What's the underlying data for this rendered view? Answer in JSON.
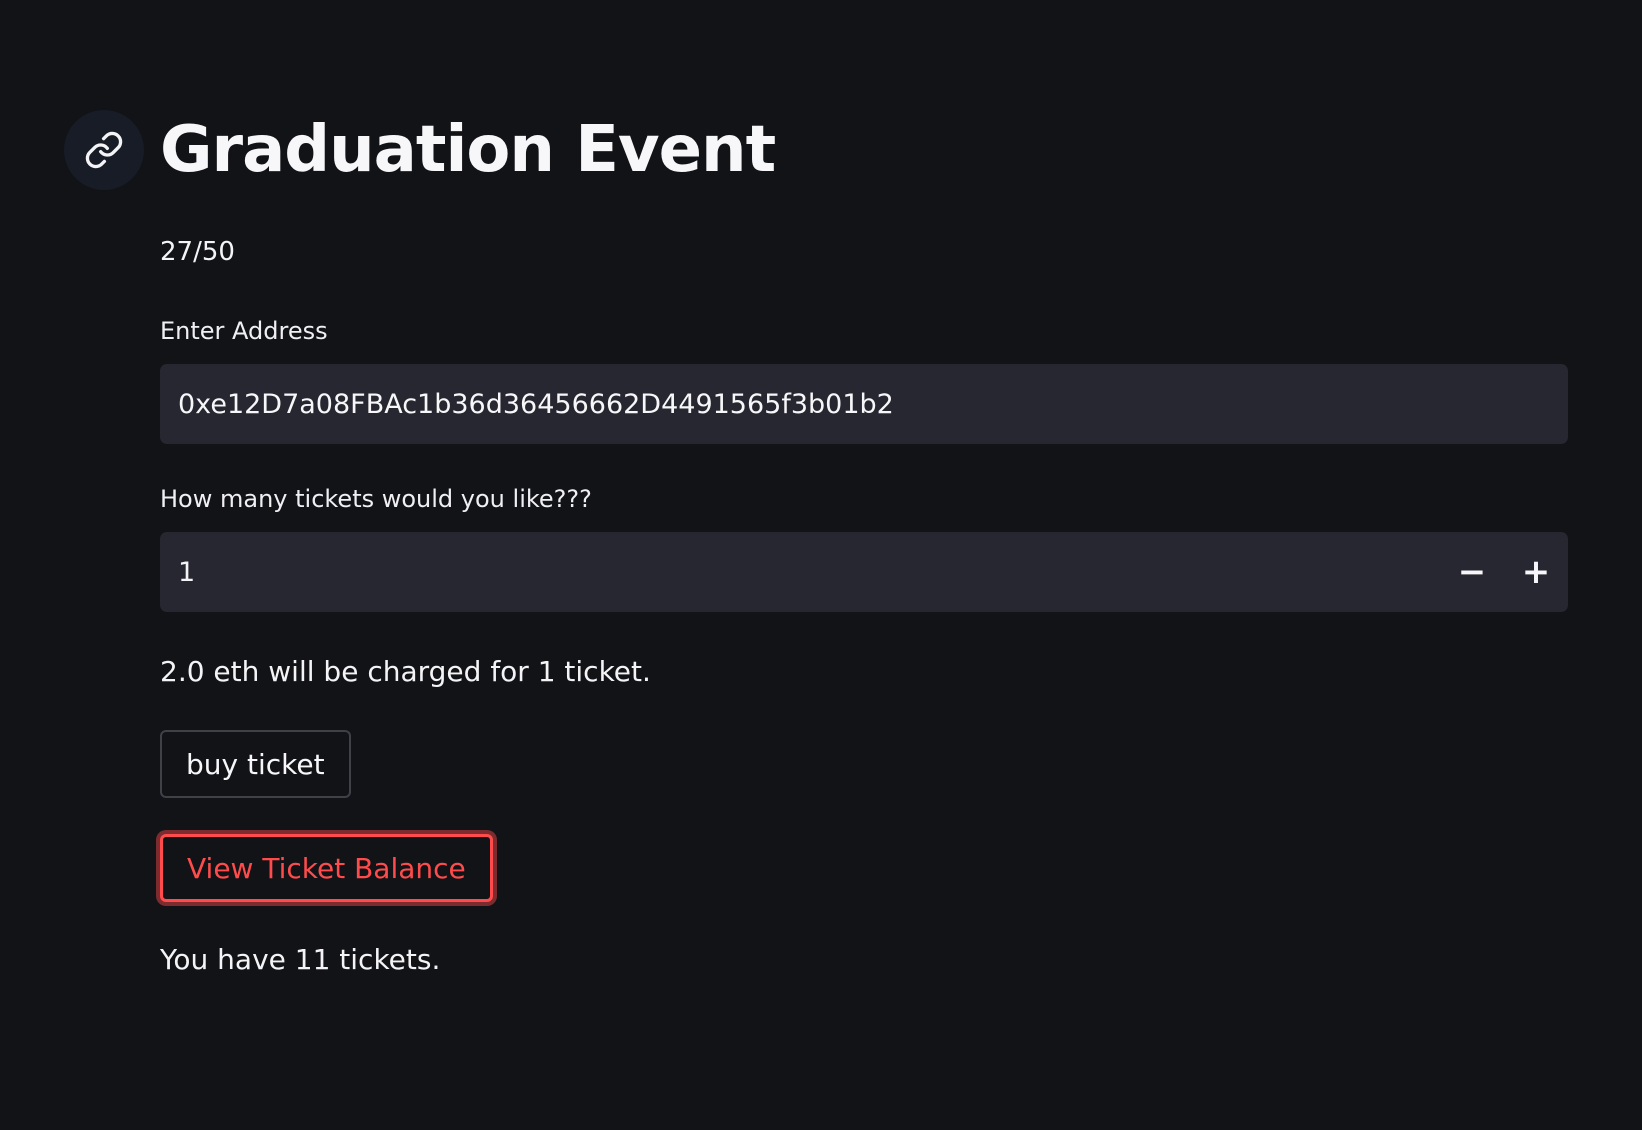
{
  "header": {
    "title": "Graduation Event",
    "anchor_icon": "link-icon"
  },
  "main": {
    "count": "27/50",
    "address_label": "Enter Address",
    "address_value": "0xe12D7a08FBAc1b36d36456662D4491565f3b01b2",
    "tickets_label": "How many tickets would you like???",
    "tickets_value": "1",
    "decrement_symbol": "−",
    "increment_symbol": "+",
    "charge_text": "2.0 eth will be charged for 1 ticket.",
    "buy_label": "buy ticket",
    "view_label": "View Ticket Balance",
    "balance_text": "You have 11 tickets."
  },
  "colors": {
    "background": "#121317",
    "input_background": "#262730",
    "accent": "#ff4b4b",
    "text": "#f7f7f9"
  }
}
